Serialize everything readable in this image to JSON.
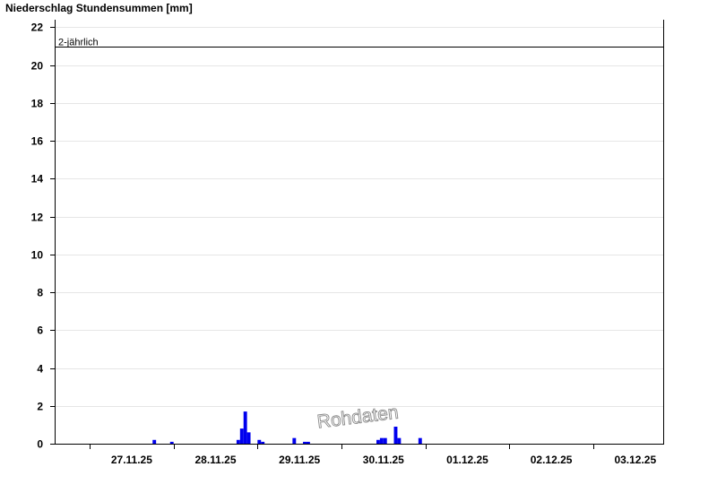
{
  "chart_data": {
    "type": "bar",
    "title": "Niederschlag Stundensummen [mm]",
    "xlabel": "",
    "ylabel": "",
    "ylim": [
      0,
      22.4
    ],
    "y_ticks": [
      0,
      2,
      4,
      6,
      8,
      10,
      12,
      14,
      16,
      18,
      20,
      22
    ],
    "x_range": [
      "2025-11-26T14:00",
      "2025-12-03T20:00"
    ],
    "x_tick_labels": [
      "27.11.25",
      "28.11.25",
      "29.11.25",
      "30.11.25",
      "01.12.25",
      "02.12.25",
      "03.12.25"
    ],
    "x_tick_dates": [
      "2025-11-27T12:00",
      "2025-11-28T12:00",
      "2025-11-29T12:00",
      "2025-11-30T12:00",
      "2025-12-01T12:00",
      "2025-12-02T12:00",
      "2025-12-03T12:00"
    ],
    "grid": true,
    "bar_color": "#0000ee",
    "reference_line": {
      "label": "2-jährlich",
      "value": 21.0
    },
    "watermark": "Rohdaten",
    "series": [
      {
        "name": "",
        "points": [
          {
            "x": "2025-11-27T18:00",
            "y": 0.2
          },
          {
            "x": "2025-11-27T23:00",
            "y": 0.1
          },
          {
            "x": "2025-11-28T18:00",
            "y": 0.2
          },
          {
            "x": "2025-11-28T19:00",
            "y": 0.8
          },
          {
            "x": "2025-11-28T20:00",
            "y": 1.7
          },
          {
            "x": "2025-11-28T21:00",
            "y": 0.6
          },
          {
            "x": "2025-11-29T00:00",
            "y": 0.2
          },
          {
            "x": "2025-11-29T01:00",
            "y": 0.1
          },
          {
            "x": "2025-11-29T10:00",
            "y": 0.3
          },
          {
            "x": "2025-11-29T13:00",
            "y": 0.1
          },
          {
            "x": "2025-11-29T14:00",
            "y": 0.1
          },
          {
            "x": "2025-11-30T10:00",
            "y": 0.2
          },
          {
            "x": "2025-11-30T11:00",
            "y": 0.3
          },
          {
            "x": "2025-11-30T12:00",
            "y": 0.3
          },
          {
            "x": "2025-11-30T15:00",
            "y": 0.9
          },
          {
            "x": "2025-11-30T16:00",
            "y": 0.3
          },
          {
            "x": "2025-11-30T22:00",
            "y": 0.3
          }
        ]
      }
    ]
  }
}
